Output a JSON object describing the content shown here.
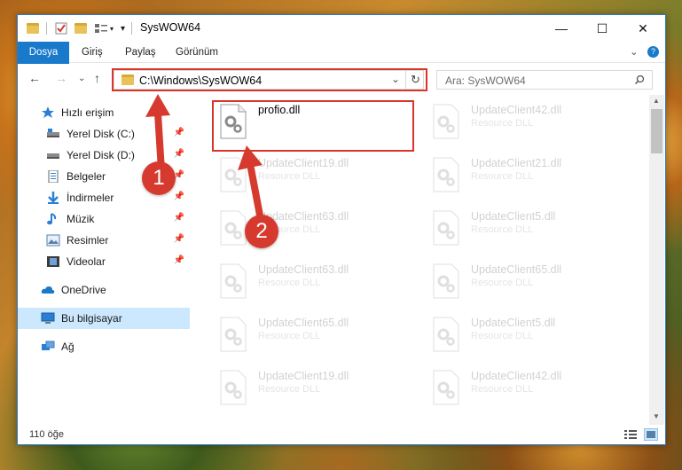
{
  "window": {
    "title": "SysWOW64",
    "minimize": "—",
    "maximize": "☐",
    "close": "✕"
  },
  "ribbon": {
    "tabs": [
      "Dosya",
      "Giriş",
      "Paylaş",
      "Görünüm"
    ],
    "collapse": "⌄",
    "help": "?"
  },
  "nav": {
    "back": "←",
    "forward": "→",
    "recent": "⌄",
    "up": "↑",
    "address": "C:\\Windows\\SysWOW64",
    "address_dropdown": "⌄",
    "refresh": "↻",
    "search_placeholder": "Ara: SysWOW64"
  },
  "sidebar": {
    "items": [
      {
        "label": "Hızlı erişim",
        "icon": "star-icon"
      },
      {
        "label": "Yerel Disk (C:)",
        "icon": "drive-icon",
        "pinned": true
      },
      {
        "label": "Yerel Disk (D:)",
        "icon": "drive-icon",
        "pinned": true
      },
      {
        "label": "Belgeler",
        "icon": "documents-icon",
        "pinned": true
      },
      {
        "label": "İndirmeler",
        "icon": "download-icon",
        "pinned": true
      },
      {
        "label": "Müzik",
        "icon": "music-icon",
        "pinned": true
      },
      {
        "label": "Resimler",
        "icon": "pictures-icon",
        "pinned": true
      },
      {
        "label": "Videolar",
        "icon": "videos-icon",
        "pinned": true
      },
      {
        "label": "OneDrive",
        "icon": "cloud-icon"
      },
      {
        "label": "Bu bilgisayar",
        "icon": "computer-icon",
        "selected": true
      },
      {
        "label": "Ağ",
        "icon": "network-icon"
      }
    ]
  },
  "files": [
    {
      "name": "profio.dll",
      "desc": ""
    },
    {
      "name": "UpdateClient42.dll",
      "desc": "Resource DLL"
    },
    {
      "name": "UpdateClient19.dll",
      "desc": "Resource DLL"
    },
    {
      "name": "UpdateClient21.dll",
      "desc": "Resource DLL"
    },
    {
      "name": "UpdateClient63.dll",
      "desc": "Resource DLL"
    },
    {
      "name": "UpdateClient5.dll",
      "desc": "Resource DLL"
    },
    {
      "name": "UpdateClient63.dll",
      "desc": "Resource DLL"
    },
    {
      "name": "UpdateClient65.dll",
      "desc": "Resource DLL"
    },
    {
      "name": "UpdateClient65.dll",
      "desc": "Resource DLL"
    },
    {
      "name": "UpdateClient5.dll",
      "desc": "Resource DLL"
    },
    {
      "name": "UpdateClient19.dll",
      "desc": "Resource DLL"
    },
    {
      "name": "UpdateClient42.dll",
      "desc": "Resource DLL"
    }
  ],
  "status": {
    "count": "110 öğe"
  },
  "annotations": {
    "step1": "1",
    "step2": "2",
    "color": "#d63a2f"
  }
}
